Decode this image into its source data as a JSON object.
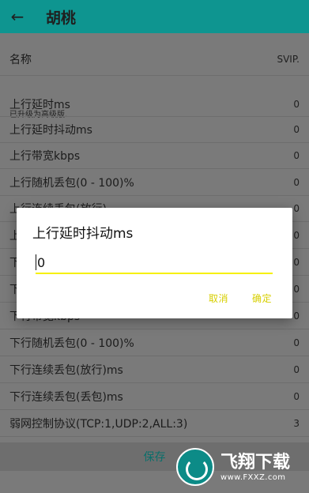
{
  "app": {
    "title": "胡桃",
    "back_icon": "arrow-left-icon"
  },
  "settings": {
    "name_label": "名称",
    "name_value": "SVIP.",
    "note": "已升级为高级版.",
    "rows": [
      {
        "label": "上行延时ms",
        "value": "0"
      },
      {
        "label": "上行延时抖动ms",
        "value": "0"
      },
      {
        "label": "上行带宽kbps",
        "value": "0"
      },
      {
        "label": "上行随机丢包(0 - 100)%",
        "value": "0"
      },
      {
        "label": "上行连续丢包(放行)",
        "value": "0"
      },
      {
        "label": "上",
        "value": "0"
      },
      {
        "label": "下",
        "value": "0"
      },
      {
        "label": "下",
        "value": "0"
      },
      {
        "label": "下行带宽kbps",
        "value": "0"
      },
      {
        "label": "下行随机丢包(0 - 100)%",
        "value": "0"
      },
      {
        "label": "下行连续丢包(放行)ms",
        "value": "0"
      },
      {
        "label": "下行连续丢包(丢包)ms",
        "value": "0"
      },
      {
        "label": "弱网控制协议(TCP:1,UDP:2,ALL:3)",
        "value": "3"
      }
    ],
    "save_label": "保存"
  },
  "dialog": {
    "title": "上行延时抖动ms",
    "input_value": "0",
    "cancel_label": "取消",
    "ok_label": "确定"
  },
  "watermark": {
    "brand": "飞翔下载",
    "url": "www.FXXZ.com"
  }
}
